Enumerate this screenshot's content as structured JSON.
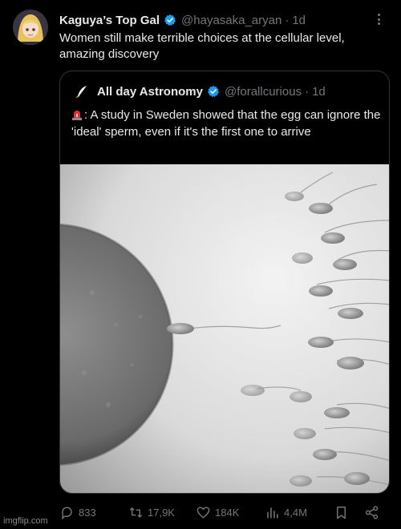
{
  "tweet": {
    "author_name": "Kaguya’s Top Gal",
    "handle": "@hayasaka_aryan",
    "separator": "·",
    "time": "1d",
    "text": "Women still make terrible choices at the cellular level, amazing discovery"
  },
  "quote": {
    "author_name": "All day Astronomy",
    "handle": "@forallcurious",
    "separator": "·",
    "time": "1d",
    "text": ": A study in Sweden showed that the egg can ignore the 'ideal' sperm, even if it's the first one to arrive"
  },
  "actions": {
    "replies": "833",
    "retweets": "17,9K",
    "likes": "184K",
    "views": "4,4M"
  },
  "watermark": "imgflip.com",
  "colors": {
    "background": "#000000",
    "text": "#e7e9ea",
    "muted": "#71767b",
    "verified": "#1d9bf0",
    "border": "#2f3336"
  }
}
